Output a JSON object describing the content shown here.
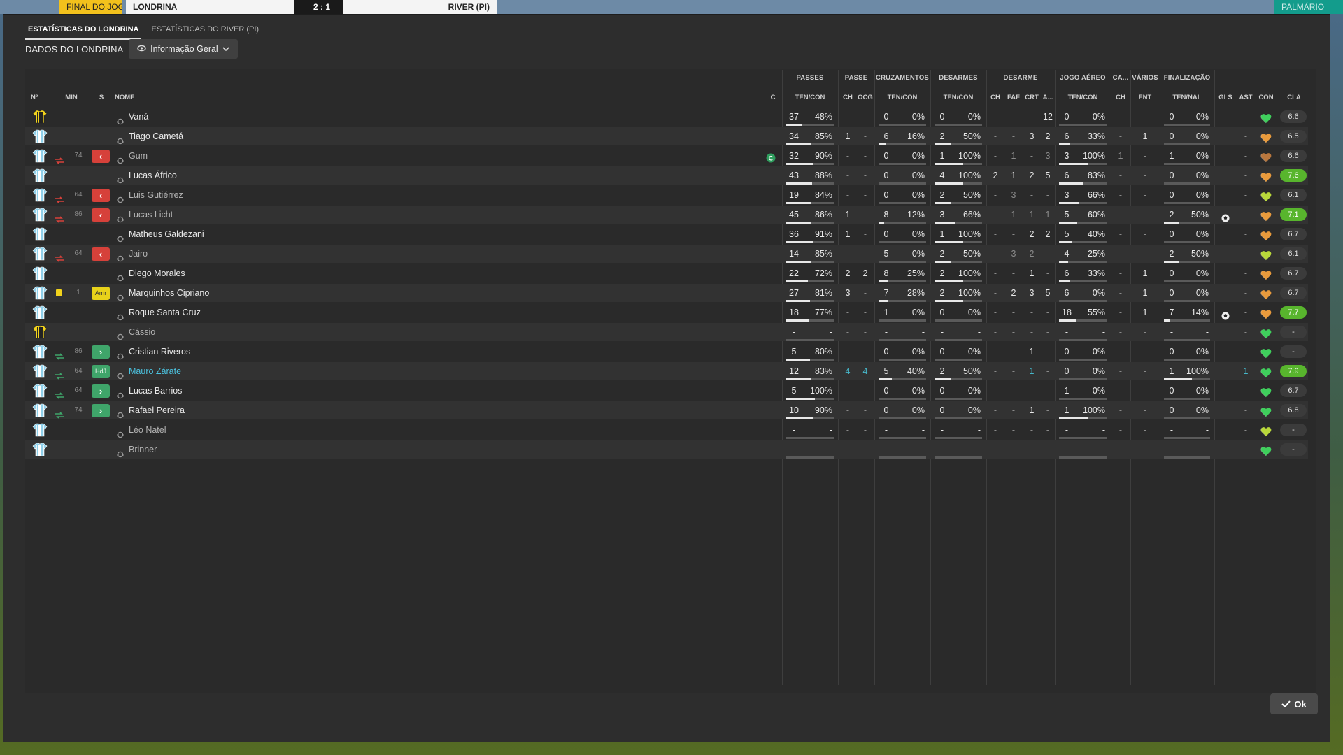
{
  "topbar": {
    "status": "FINAL DO JOGO",
    "home": "LONDRINA",
    "score": "2 : 1",
    "away": "RIVER (PI)",
    "right_label": "PALMÁRIO"
  },
  "tabs": [
    {
      "label": "ESTATÍSTICAS DO LONDRINA",
      "active": true
    },
    {
      "label": "ESTATÍSTICAS DO RIVER (PI)",
      "active": false
    }
  ],
  "section": {
    "title": "DADOS DO LONDRINA",
    "dropdown": "Informação Geral"
  },
  "groups": {
    "passes": "PASSES",
    "passe": "PASSE",
    "cruz": "CRUZAMENTOS",
    "desarmes": "DESARMES",
    "desarme": "DESARME",
    "aereo": "JOGO AÉREO",
    "ca": "CA...",
    "varios": "VÁRIOS",
    "final": "FINALIZAÇÃO"
  },
  "headers": {
    "num": "Nº",
    "min": "MIN",
    "s": "S",
    "nome": "NOME",
    "c": "C",
    "pas_tc": "TEN/CON",
    "pa_ch": "CH",
    "pa_ocg": "OCG",
    "cr_tc": "TEN/CON",
    "de_tc": "TEN/CON",
    "ds_ch": "CH",
    "ds_faf": "FAF",
    "ds_crt": "CRT",
    "ds_a": "A...",
    "ae_tc": "TEN/CON",
    "ca_ch": "CH",
    "va_fnt": "FNT",
    "fi_tn": "TEN/NAL",
    "gls": "GLS",
    "ast": "AST",
    "con": "CON",
    "cla": "CLA"
  },
  "ok_label": "Ok",
  "rows": [
    {
      "name": "Vaná",
      "kit": "gk",
      "min": "",
      "sub": "",
      "card": "",
      "cap": false,
      "pas": [
        "37",
        "48%"
      ],
      "pas_pct": 48,
      "pch": "-",
      "ocg": "-",
      "cr": [
        "0",
        "0%"
      ],
      "de": [
        "0",
        "0%"
      ],
      "dch": "-",
      "faf": "-",
      "crt": "-",
      "da": "12",
      "ae": [
        "0",
        "0%"
      ],
      "cach": "-",
      "fnt": "-",
      "fi": [
        "0",
        "0%"
      ],
      "gls": "",
      "ast": "-",
      "heart": "green",
      "rating": "6.6",
      "good": false
    },
    {
      "name": "Tiago Cametá",
      "kit": "field",
      "min": "",
      "sub": "",
      "card": "",
      "cap": false,
      "pas": [
        "34",
        "85%"
      ],
      "pas_pct": 85,
      "pch": "1",
      "ocg": "-",
      "cr": [
        "6",
        "16%"
      ],
      "de": [
        "2",
        "50%"
      ],
      "dch": "-",
      "faf": "-",
      "crt": "3",
      "da": "2",
      "ae": [
        "6",
        "33%"
      ],
      "cach": "-",
      "fnt": "1",
      "fi": [
        "0",
        "0%"
      ],
      "gls": "",
      "ast": "-",
      "heart": "orange",
      "rating": "6.5",
      "good": false
    },
    {
      "name": "Gum",
      "kit": "field",
      "min": "74",
      "sub": "out",
      "card": "",
      "cap": true,
      "dimname": true,
      "pas": [
        "32",
        "90%"
      ],
      "pas_pct": 90,
      "pch": "-",
      "ocg": "-",
      "cr": [
        "0",
        "0%"
      ],
      "de": [
        "1",
        "100%"
      ],
      "dch": "-",
      "faf": "1",
      "crt": "-",
      "da": "3",
      "ae": [
        "3",
        "100%"
      ],
      "cach": "1",
      "fnt": "-",
      "fi": [
        "1",
        "0%"
      ],
      "gls": "",
      "ast": "-",
      "heart": "brown",
      "rating": "6.6",
      "good": false
    },
    {
      "name": "Lucas Áfrico",
      "kit": "field",
      "min": "",
      "sub": "",
      "card": "",
      "cap": false,
      "pas": [
        "43",
        "88%"
      ],
      "pas_pct": 88,
      "pch": "-",
      "ocg": "-",
      "cr": [
        "0",
        "0%"
      ],
      "de": [
        "4",
        "100%"
      ],
      "dch": "2",
      "faf": "1",
      "crt": "2",
      "da": "5",
      "ae": [
        "6",
        "83%"
      ],
      "cach": "-",
      "fnt": "-",
      "fi": [
        "0",
        "0%"
      ],
      "gls": "",
      "ast": "-",
      "heart": "orange",
      "rating": "7.6",
      "good": true
    },
    {
      "name": "Luis Gutiérrez",
      "kit": "field",
      "min": "64",
      "sub": "out",
      "card": "",
      "cap": false,
      "dimname": true,
      "pas": [
        "19",
        "84%"
      ],
      "pas_pct": 84,
      "pch": "-",
      "ocg": "-",
      "cr": [
        "0",
        "0%"
      ],
      "de": [
        "2",
        "50%"
      ],
      "dch": "-",
      "faf": "3",
      "crt": "-",
      "da": "-",
      "ae": [
        "3",
        "66%"
      ],
      "cach": "-",
      "fnt": "-",
      "fi": [
        "0",
        "0%"
      ],
      "gls": "",
      "ast": "-",
      "heart": "yellow",
      "rating": "6.1",
      "good": false
    },
    {
      "name": "Lucas Licht",
      "kit": "field",
      "min": "86",
      "sub": "out",
      "card": "",
      "cap": false,
      "dimname": true,
      "pas": [
        "45",
        "86%"
      ],
      "pas_pct": 86,
      "pch": "1",
      "ocg": "-",
      "cr": [
        "8",
        "12%"
      ],
      "de": [
        "3",
        "66%"
      ],
      "dch": "-",
      "faf": "1",
      "crt": "1",
      "da": "1",
      "ae": [
        "5",
        "60%"
      ],
      "cach": "-",
      "fnt": "-",
      "fi": [
        "2",
        "50%"
      ],
      "gls": "ball",
      "ast": "-",
      "heart": "orange",
      "rating": "7.1",
      "good": true
    },
    {
      "name": "Matheus Galdezani",
      "kit": "field",
      "min": "",
      "sub": "",
      "card": "",
      "cap": false,
      "pas": [
        "36",
        "91%"
      ],
      "pas_pct": 91,
      "pch": "1",
      "ocg": "-",
      "cr": [
        "0",
        "0%"
      ],
      "de": [
        "1",
        "100%"
      ],
      "dch": "-",
      "faf": "-",
      "crt": "2",
      "da": "2",
      "ae": [
        "5",
        "40%"
      ],
      "cach": "-",
      "fnt": "-",
      "fi": [
        "0",
        "0%"
      ],
      "gls": "",
      "ast": "-",
      "heart": "orange",
      "rating": "6.7",
      "good": false
    },
    {
      "name": "Jairo",
      "kit": "field",
      "min": "64",
      "sub": "out",
      "card": "",
      "cap": false,
      "dimname": true,
      "pas": [
        "14",
        "85%"
      ],
      "pas_pct": 85,
      "pch": "-",
      "ocg": "-",
      "cr": [
        "5",
        "0%"
      ],
      "de": [
        "2",
        "50%"
      ],
      "dch": "-",
      "faf": "3",
      "crt": "2",
      "da": "-",
      "ae": [
        "4",
        "25%"
      ],
      "cach": "-",
      "fnt": "-",
      "fi": [
        "2",
        "50%"
      ],
      "gls": "",
      "ast": "-",
      "heart": "yellow",
      "rating": "6.1",
      "good": false
    },
    {
      "name": "Diego Morales",
      "kit": "field",
      "min": "",
      "sub": "",
      "card": "",
      "cap": false,
      "pas": [
        "22",
        "72%"
      ],
      "pas_pct": 72,
      "pch": "2",
      "ocg": "2",
      "cr": [
        "8",
        "25%"
      ],
      "de": [
        "2",
        "100%"
      ],
      "dch": "-",
      "faf": "-",
      "crt": "1",
      "da": "-",
      "ae": [
        "6",
        "33%"
      ],
      "cach": "-",
      "fnt": "1",
      "fi": [
        "0",
        "0%"
      ],
      "gls": "",
      "ast": "-",
      "heart": "orange",
      "rating": "6.7",
      "good": false
    },
    {
      "name": "Marquinhos Cipriano",
      "kit": "field",
      "min": "1",
      "sub": "amr",
      "card": "yellow",
      "cap": false,
      "pas": [
        "27",
        "81%"
      ],
      "pas_pct": 81,
      "pch": "3",
      "ocg": "-",
      "cr": [
        "7",
        "28%"
      ],
      "de": [
        "2",
        "100%"
      ],
      "dch": "-",
      "faf": "2",
      "crt": "3",
      "da": "5",
      "ae": [
        "6",
        "0%"
      ],
      "cach": "-",
      "fnt": "1",
      "fi": [
        "0",
        "0%"
      ],
      "gls": "",
      "ast": "-",
      "heart": "orange",
      "rating": "6.7",
      "good": false
    },
    {
      "name": "Roque Santa Cruz",
      "kit": "field",
      "min": "",
      "sub": "",
      "card": "",
      "cap": false,
      "pas": [
        "18",
        "77%"
      ],
      "pas_pct": 77,
      "pch": "-",
      "ocg": "-",
      "cr": [
        "1",
        "0%"
      ],
      "de": [
        "0",
        "0%"
      ],
      "dch": "-",
      "faf": "-",
      "crt": "-",
      "da": "-",
      "ae": [
        "18",
        "55%"
      ],
      "cach": "-",
      "fnt": "1",
      "fi": [
        "7",
        "14%"
      ],
      "gls": "ball",
      "ast": "-",
      "heart": "orange",
      "rating": "7.7",
      "good": true
    },
    {
      "name": "Cássio",
      "kit": "gk",
      "min": "",
      "sub": "",
      "card": "",
      "cap": false,
      "dimname": true,
      "pas": [
        "-",
        "-"
      ],
      "pas_pct": 0,
      "pch": "-",
      "ocg": "-",
      "cr": [
        "-",
        "-"
      ],
      "de": [
        "-",
        "-"
      ],
      "dch": "-",
      "faf": "-",
      "crt": "-",
      "da": "-",
      "ae": [
        "-",
        "-"
      ],
      "cach": "-",
      "fnt": "-",
      "fi": [
        "-",
        "-"
      ],
      "gls": "",
      "ast": "-",
      "heart": "green",
      "rating": "-",
      "good": false
    },
    {
      "name": "Cristian Riveros",
      "kit": "field",
      "min": "86",
      "sub": "in",
      "card": "",
      "cap": false,
      "pas": [
        "5",
        "80%"
      ],
      "pas_pct": 80,
      "pch": "-",
      "ocg": "-",
      "cr": [
        "0",
        "0%"
      ],
      "de": [
        "0",
        "0%"
      ],
      "dch": "-",
      "faf": "-",
      "crt": "1",
      "da": "-",
      "ae": [
        "0",
        "0%"
      ],
      "cach": "-",
      "fnt": "-",
      "fi": [
        "0",
        "0%"
      ],
      "gls": "",
      "ast": "-",
      "heart": "green",
      "rating": "-",
      "good": false
    },
    {
      "name": "Mauro Zárate",
      "kit": "field",
      "min": "64",
      "sub": "hdj",
      "card": "",
      "cap": false,
      "link": true,
      "pas": [
        "12",
        "83%"
      ],
      "pas_pct": 83,
      "pch": "4",
      "ocg": "4",
      "cr": [
        "5",
        "40%"
      ],
      "de": [
        "2",
        "50%"
      ],
      "dch": "-",
      "faf": "-",
      "crt": "1",
      "da": "-",
      "ae": [
        "0",
        "0%"
      ],
      "cach": "-",
      "fnt": "-",
      "fi": [
        "1",
        "100%"
      ],
      "gls": "",
      "ast": "1",
      "heart": "green",
      "rating": "7.9",
      "good": true
    },
    {
      "name": "Lucas Barrios",
      "kit": "field",
      "min": "64",
      "sub": "in",
      "card": "",
      "cap": false,
      "pas": [
        "5",
        "100%"
      ],
      "pas_pct": 100,
      "pch": "-",
      "ocg": "-",
      "cr": [
        "0",
        "0%"
      ],
      "de": [
        "0",
        "0%"
      ],
      "dch": "-",
      "faf": "-",
      "crt": "-",
      "da": "-",
      "ae": [
        "1",
        "0%"
      ],
      "cach": "-",
      "fnt": "-",
      "fi": [
        "0",
        "0%"
      ],
      "gls": "",
      "ast": "-",
      "heart": "green",
      "rating": "6.7",
      "good": false
    },
    {
      "name": "Rafael Pereira",
      "kit": "field",
      "min": "74",
      "sub": "in",
      "card": "",
      "cap": false,
      "pas": [
        "10",
        "90%"
      ],
      "pas_pct": 90,
      "pch": "-",
      "ocg": "-",
      "cr": [
        "0",
        "0%"
      ],
      "de": [
        "0",
        "0%"
      ],
      "dch": "-",
      "faf": "-",
      "crt": "1",
      "da": "-",
      "ae": [
        "1",
        "100%"
      ],
      "cach": "-",
      "fnt": "-",
      "fi": [
        "0",
        "0%"
      ],
      "gls": "",
      "ast": "-",
      "heart": "green",
      "rating": "6.8",
      "good": false
    },
    {
      "name": "Léo Natel",
      "kit": "field",
      "min": "",
      "sub": "",
      "card": "",
      "cap": false,
      "dimname": true,
      "pas": [
        "-",
        "-"
      ],
      "pas_pct": 0,
      "pch": "-",
      "ocg": "-",
      "cr": [
        "-",
        "-"
      ],
      "de": [
        "-",
        "-"
      ],
      "dch": "-",
      "faf": "-",
      "crt": "-",
      "da": "-",
      "ae": [
        "-",
        "-"
      ],
      "cach": "-",
      "fnt": "-",
      "fi": [
        "-",
        "-"
      ],
      "gls": "",
      "ast": "-",
      "heart": "yellow",
      "rating": "-",
      "good": false
    },
    {
      "name": "Brinner",
      "kit": "field",
      "min": "",
      "sub": "",
      "card": "",
      "cap": false,
      "dimname": true,
      "pas": [
        "-",
        "-"
      ],
      "pas_pct": 0,
      "pch": "-",
      "ocg": "-",
      "cr": [
        "-",
        "-"
      ],
      "de": [
        "-",
        "-"
      ],
      "dch": "-",
      "faf": "-",
      "crt": "-",
      "da": "-",
      "ae": [
        "-",
        "-"
      ],
      "cach": "-",
      "fnt": "-",
      "fi": [
        "-",
        "-"
      ],
      "gls": "",
      "ast": "-",
      "heart": "green",
      "rating": "-",
      "good": false
    }
  ],
  "colors": {
    "accent_green": "#58b52d",
    "sub_out": "#d6413a",
    "sub_in": "#3fa56a",
    "link": "#4cc3e0"
  }
}
